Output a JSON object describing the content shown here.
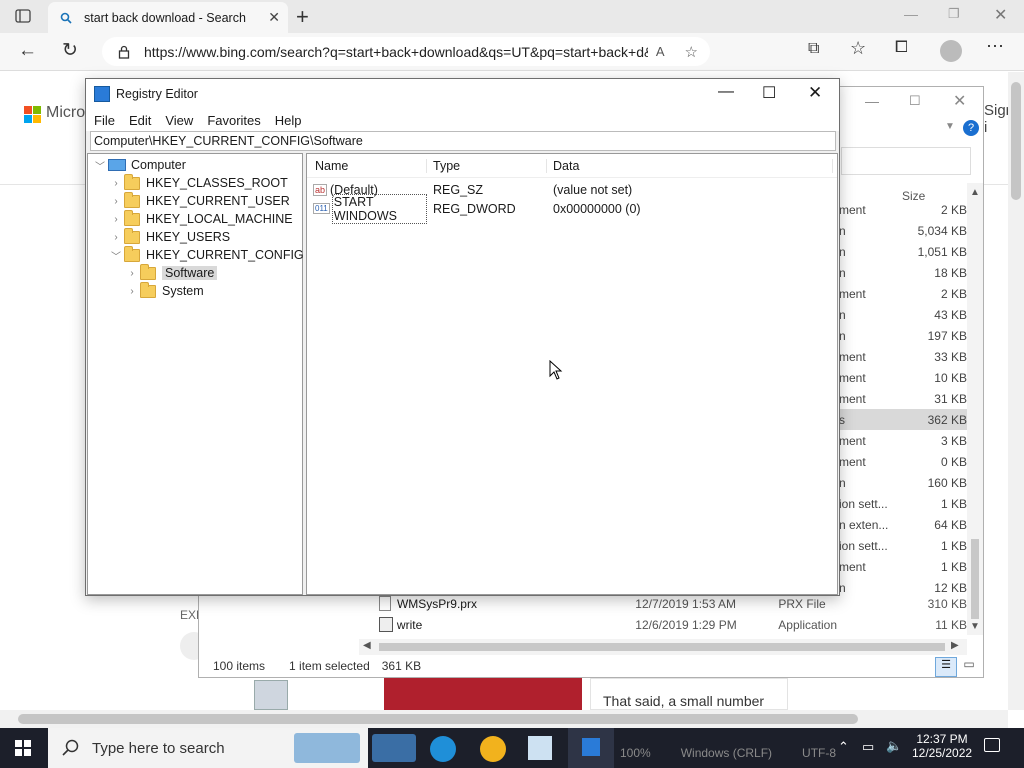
{
  "browser": {
    "tab_title": "start back download - Search",
    "url": "https://www.bing.com/search?q=start+back+download&qs=UT&pq=start+back+d&sc...",
    "new_tab": "+"
  },
  "page": {
    "brand": "Micro",
    "sign_in": "Sign i",
    "explore": "EXP",
    "article_text": "That said, a small number"
  },
  "explorer": {
    "size_header": "Size",
    "rows": [
      {
        "type": "ment",
        "size": "2 KB"
      },
      {
        "type": "n",
        "size": "5,034 KB"
      },
      {
        "type": "n",
        "size": "1,051 KB"
      },
      {
        "type": "n",
        "size": "18 KB"
      },
      {
        "type": "ment",
        "size": "2 KB"
      },
      {
        "type": "n",
        "size": "43 KB"
      },
      {
        "type": "n",
        "size": "197 KB"
      },
      {
        "type": "ment",
        "size": "33 KB"
      },
      {
        "type": "ment",
        "size": "10 KB"
      },
      {
        "type": "ment",
        "size": "31 KB"
      },
      {
        "type": "s",
        "size": "362 KB"
      },
      {
        "type": "ment",
        "size": "3 KB"
      },
      {
        "type": "ment",
        "size": "0 KB"
      },
      {
        "type": "n",
        "size": "160 KB"
      },
      {
        "type": "ion sett...",
        "size": "1 KB"
      },
      {
        "type": "n exten...",
        "size": "64 KB"
      },
      {
        "type": "ion sett...",
        "size": "1 KB"
      },
      {
        "type": "ment",
        "size": "1 KB"
      },
      {
        "type": "n",
        "size": "12 KB"
      }
    ],
    "file_rows": [
      {
        "name": "WMSysPr9.prx",
        "date": "12/7/2019 1:53 AM",
        "type": "PRX File",
        "size": "310 KB"
      },
      {
        "name": "write",
        "date": "12/6/2019 1:29 PM",
        "type": "Application",
        "size": "11 KB"
      }
    ],
    "status_items": "100 items",
    "status_selected": "1 item selected",
    "status_size": "361 KB"
  },
  "regedit": {
    "title": "Registry Editor",
    "menu": [
      "File",
      "Edit",
      "View",
      "Favorites",
      "Help"
    ],
    "path": "Computer\\HKEY_CURRENT_CONFIG\\Software",
    "tree": {
      "root": "Computer",
      "hives": [
        "HKEY_CLASSES_ROOT",
        "HKEY_CURRENT_USER",
        "HKEY_LOCAL_MACHINE",
        "HKEY_USERS",
        "HKEY_CURRENT_CONFIG"
      ],
      "children": [
        "Software",
        "System"
      ]
    },
    "columns": {
      "name": "Name",
      "type": "Type",
      "data": "Data"
    },
    "values": [
      {
        "name": "(Default)",
        "type": "REG_SZ",
        "data": "(value not set)",
        "icon": "ab"
      },
      {
        "name": "START WINDOWS",
        "type": "REG_DWORD",
        "data": "0x00000000 (0)",
        "icon": "011"
      }
    ]
  },
  "taskbar": {
    "search_placeholder": "Type here to search",
    "time": "12:37 PM",
    "date": "12/25/2022",
    "notepad_status": [
      "100%",
      "Windows (CRLF)",
      "UTF-8"
    ]
  }
}
